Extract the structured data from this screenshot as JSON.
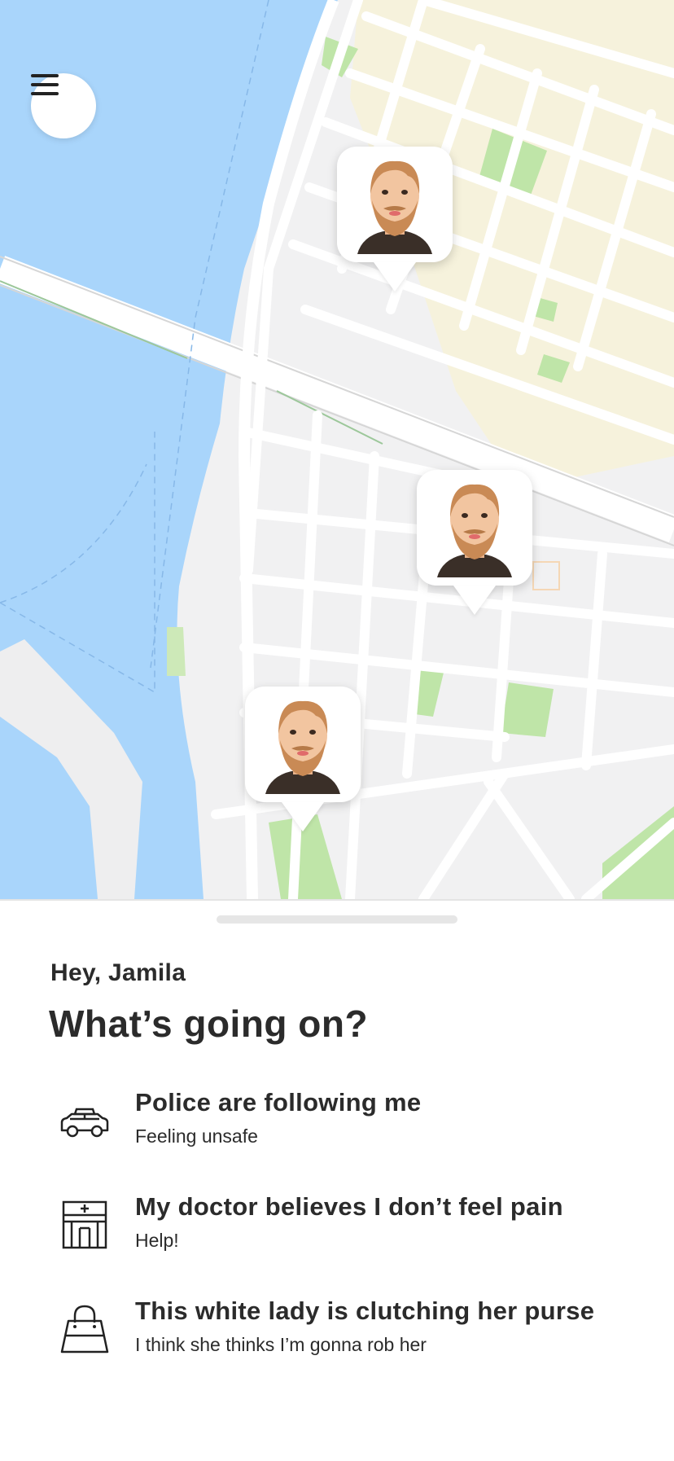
{
  "map": {
    "menu_icon": "hamburger-icon",
    "markers": [
      {
        "name": "user-avatar-marker-1",
        "icon": "bearded-man-avatar"
      },
      {
        "name": "user-avatar-marker-2",
        "icon": "bearded-man-avatar"
      },
      {
        "name": "user-avatar-marker-3",
        "icon": "bearded-man-avatar"
      }
    ],
    "colors": {
      "water": "#a9d5fb",
      "land": "#f1f1f2",
      "park": "#bfe5a8",
      "block_tint": "#f6f2dc",
      "road": "#ffffff"
    }
  },
  "sheet": {
    "greeting": "Hey, Jamila",
    "title": "What’s going on?",
    "options": [
      {
        "icon": "police-car-icon",
        "label": "Police are following me",
        "sub": "Feeling unsafe"
      },
      {
        "icon": "hospital-icon",
        "label": "My doctor believes I don’t feel pain",
        "sub": "Help!"
      },
      {
        "icon": "purse-icon",
        "label": "This white lady is clutching her purse",
        "sub": "I think she thinks I’m gonna rob her"
      }
    ]
  }
}
